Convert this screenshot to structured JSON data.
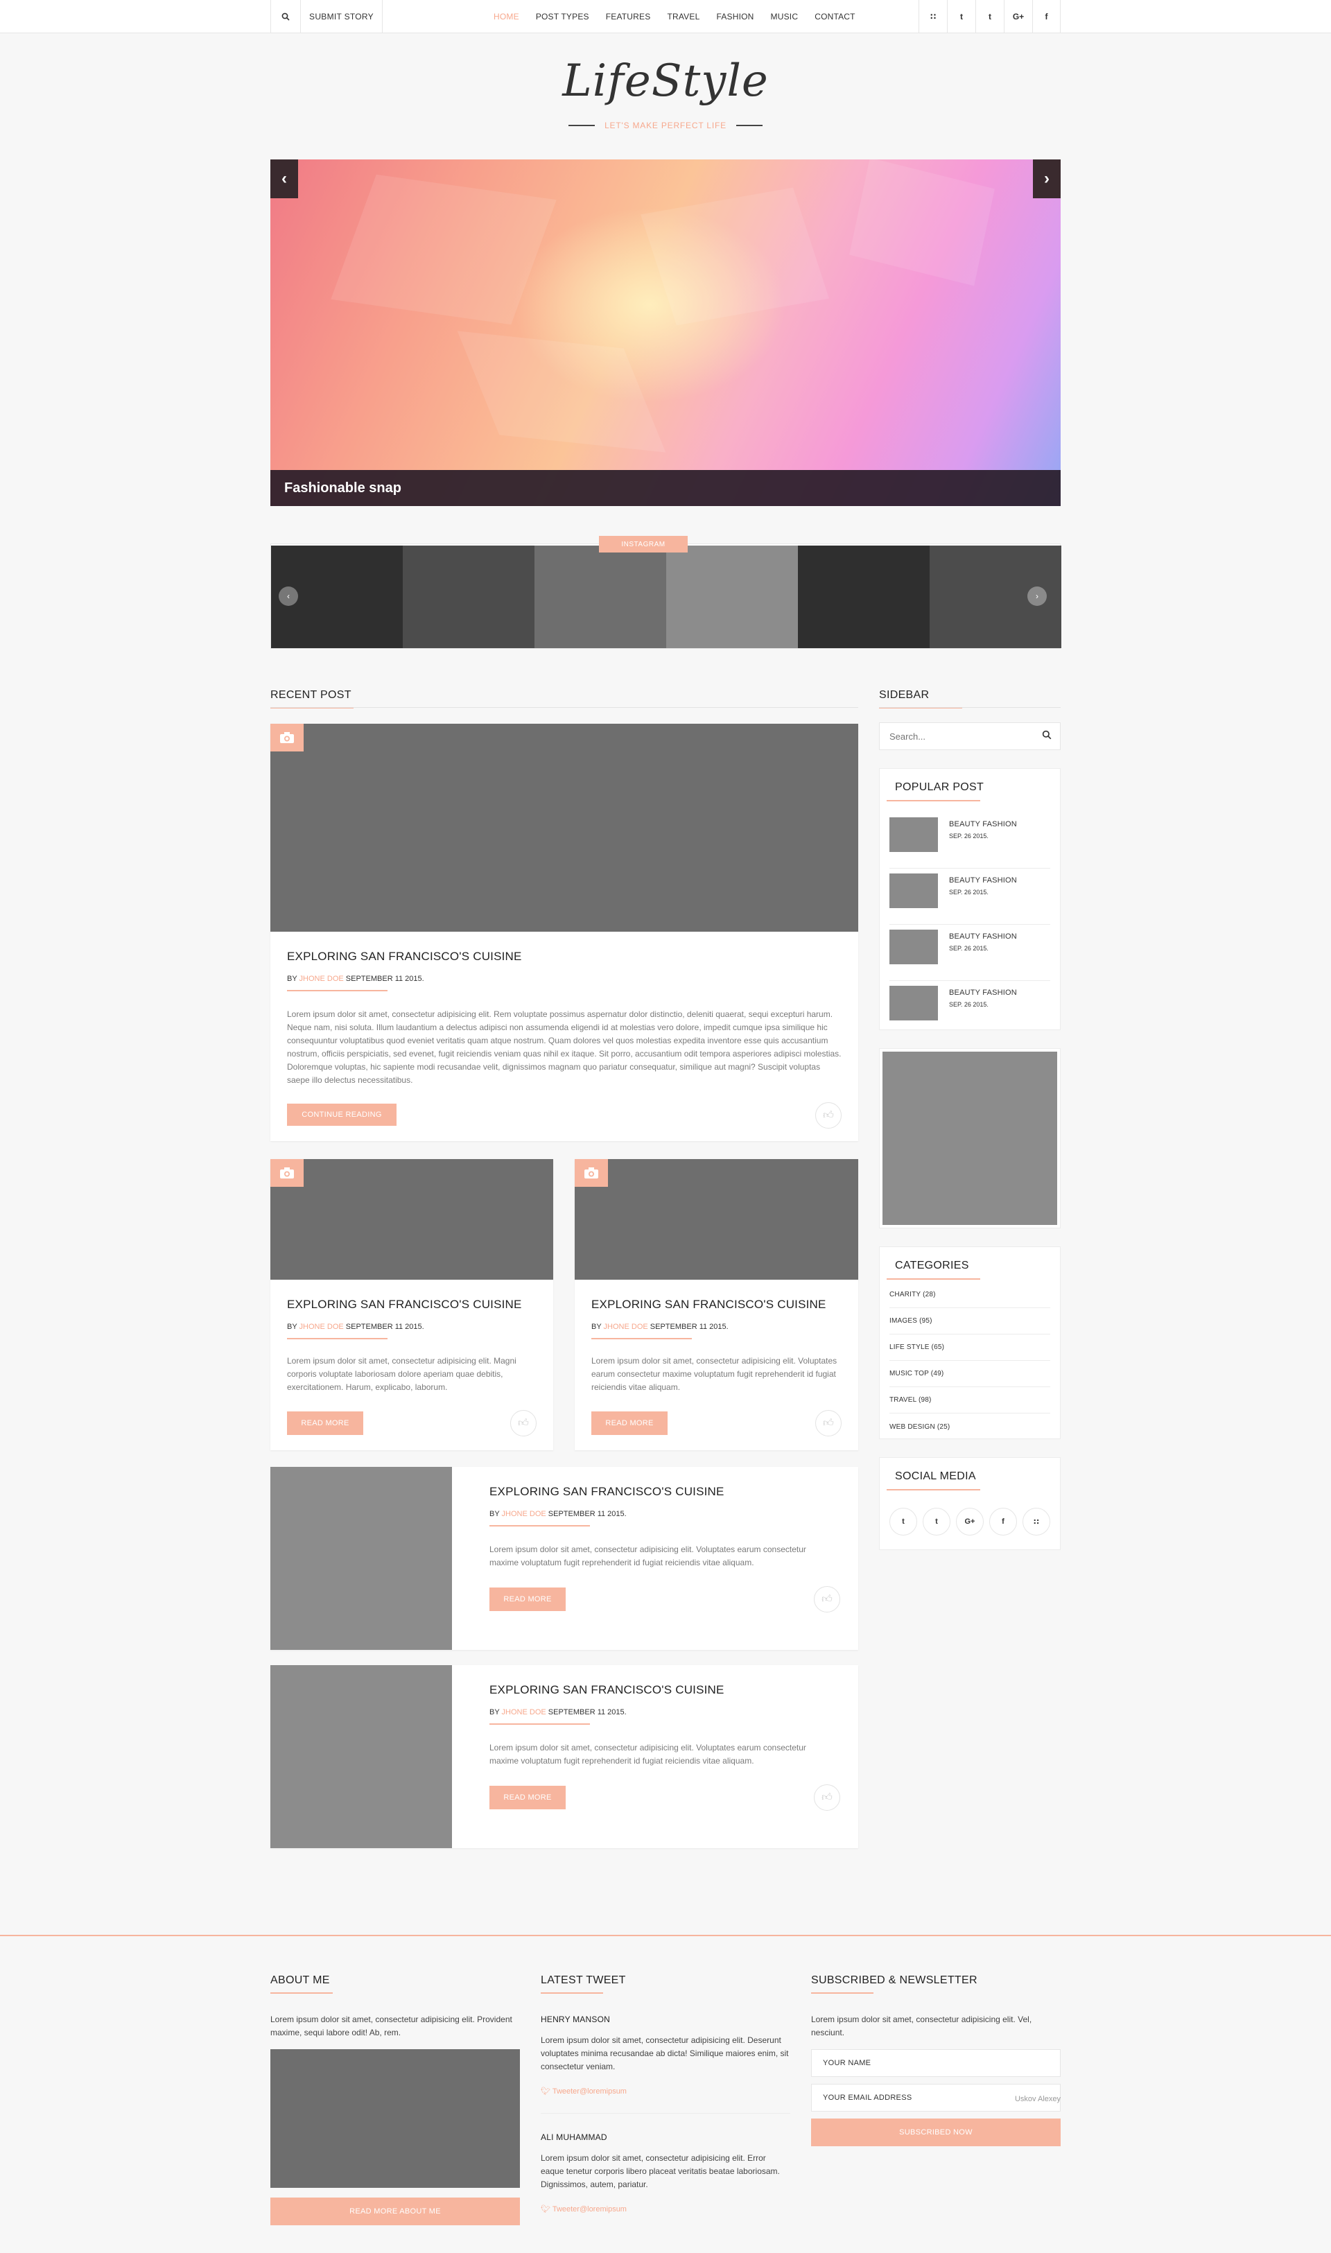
{
  "topbar": {
    "submit_label": "SUBMIT STORY",
    "menu": [
      "HOME",
      "POST TYPES",
      "FEATURES",
      "TRAVEL",
      "FASHION",
      "MUSIC",
      "CONTACT"
    ],
    "active_menu": "HOME",
    "social": [
      "rss-icon",
      "twitter-icon",
      "tumblr-icon",
      "google-plus-icon",
      "facebook-icon"
    ],
    "social_glyphs": [
      "∷",
      "t",
      "t",
      "G+",
      "f"
    ]
  },
  "brand": {
    "logo": "LifeStyle",
    "tagline": "LET'S MAKE PERFECT LIFE",
    "accent_color": "#f7b59e"
  },
  "slider": {
    "caption": "Fashionable snap",
    "prev_glyph": "‹",
    "next_glyph": "›"
  },
  "instagram": {
    "label": "INSTAGRAM",
    "tiles": [
      "#2f2f2f",
      "#4c4c4c",
      "#6e6e6e",
      "#8c8c8c",
      "#2f2f2f",
      "#4c4c4c"
    ],
    "prev_glyph": "‹",
    "next_glyph": "›"
  },
  "recent": {
    "title": "RECENT POST"
  },
  "featured_post": {
    "title": "EXPLORING SAN FRANCISCO'S CUISINE",
    "by": "BY",
    "author": "JHONE DOE",
    "date": "SEPTEMBER 11 2015.",
    "excerpt": "Lorem ipsum dolor sit amet, consectetur adipisicing elit. Rem voluptate possimus aspernatur dolor distinctio, deleniti quaerat, sequi excepturi harum. Neque nam, nisi soluta. Illum laudantium a delectus adipisci non assumenda eligendi id at molestias vero dolore, impedit cumque ipsa similique hic consequuntur voluptatibus quod eveniet veritatis quam atque nostrum. Quam dolores vel quos molestias expedita inventore esse quis accusantium nostrum, officiis perspiciatis, sed evenet, fugit reiciendis veniam quas nihil ex itaque. Sit porro, accusantium odit tempora asperiores adipisci molestias. Doloremque voluptas, hic sapiente modi recusandae velit, dignissimos magnam quo pariatur consequatur, similique aut magni? Suscipit voluptas saepe illo delectus necessitatibus.",
    "button": "CONTINUE READING"
  },
  "grid_posts": [
    {
      "title": "EXPLORING SAN FRANCISCO'S CUISINE",
      "by": "BY",
      "author": "JHONE DOE",
      "date": "SEPTEMBER 11 2015.",
      "excerpt": "Lorem ipsum dolor sit amet, consectetur adipisicing elit. Magni corporis voluptate laboriosam dolore aperiam quae debitis, exercitationem. Harum, explicabo, laborum.",
      "button": "READ MORE"
    },
    {
      "title": "EXPLORING SAN FRANCISCO'S CUISINE",
      "by": "BY",
      "author": "JHONE DOE",
      "date": "SEPTEMBER 11 2015.",
      "excerpt": "Lorem ipsum dolor sit amet, consectetur adipisicing elit. Voluptates earum consectetur maxime voluptatum fugit reprehenderit id fugiat reiciendis vitae aliquam.",
      "button": "READ MORE"
    }
  ],
  "list_posts": [
    {
      "title": "EXPLORING SAN FRANCISCO'S CUISINE",
      "by": "BY",
      "author": "JHONE DOE",
      "date": "SEPTEMBER 11 2015.",
      "excerpt": "Lorem ipsum dolor sit amet, consectetur adipisicing elit. Voluptates earum consectetur maxime voluptatum fugit reprehenderit id fugiat reiciendis vitae aliquam.",
      "button": "READ MORE"
    },
    {
      "title": "EXPLORING SAN FRANCISCO'S CUISINE",
      "by": "BY",
      "author": "JHONE DOE",
      "date": "SEPTEMBER 11 2015.",
      "excerpt": "Lorem ipsum dolor sit amet, consectetur adipisicing elit. Voluptates earum consectetur maxime voluptatum fugit reprehenderit id fugiat reiciendis vitae aliquam.",
      "button": "READ MORE"
    }
  ],
  "sidebar": {
    "title": "SIDEBAR",
    "search_placeholder": "Search...",
    "popular": {
      "title": "POPULAR POST",
      "items": [
        {
          "name": "BEAUTY FASHION",
          "date": "SEP. 26 2015."
        },
        {
          "name": "BEAUTY FASHION",
          "date": "SEP. 26 2015."
        },
        {
          "name": "BEAUTY FASHION",
          "date": "SEP. 26 2015."
        },
        {
          "name": "BEAUTY FASHION",
          "date": "SEP. 26 2015."
        }
      ]
    },
    "categories": {
      "title": "CATEGORIES",
      "items": [
        "CHARITY (28)",
        "IMAGES (95)",
        "LIFE STYLE (65)",
        "MUSIC TOP (49)",
        "TRAVEL (98)",
        "WEB DESIGN (25)"
      ]
    },
    "social": {
      "title": "SOCIAL MEDIA",
      "icons": [
        "twitter-icon",
        "tumblr-icon",
        "google-plus-icon",
        "facebook-icon",
        "rss-icon"
      ],
      "glyphs": [
        "t",
        "t",
        "G+",
        "f",
        "∷"
      ]
    }
  },
  "footer": {
    "about": {
      "title": "ABOUT ME",
      "text": "Lorem ipsum dolor sit amet, consectetur adipisicing elit. Provident maxime, sequi labore odit! Ab, rem.",
      "button": "READ MORE ABOUT ME"
    },
    "tweets": {
      "title": "LATEST TWEET",
      "items": [
        {
          "name": "HENRY MANSON",
          "text": "Lorem ipsum dolor sit amet, consectetur adipisicing elit. Deserunt voluptates minima recusandae ab dicta! Similique maiores enim, sit consectetur veniam.",
          "link": "Tweeter@loremipsum"
        },
        {
          "name": "ALI MUHAMMAD",
          "text": "Lorem ipsum dolor sit amet, consectetur adipisicing elit. Error eaque tenetur corporis libero placeat veritatis beatae laboriosam. Dignissimos, autem, pariatur.",
          "link": "Tweeter@loremipsum"
        }
      ]
    },
    "newsletter": {
      "title": "SUBSCRIBED & NEWSLETTER",
      "text": "Lorem ipsum dolor sit amet, consectetur adipisicing elit. Vel, nesciunt.",
      "name_placeholder": "YOUR NAME",
      "email_placeholder": "YOUR EMAIL ADDRESS",
      "button": "SUBSCRIBED NOW"
    },
    "credit": "Uskov Alexey"
  }
}
